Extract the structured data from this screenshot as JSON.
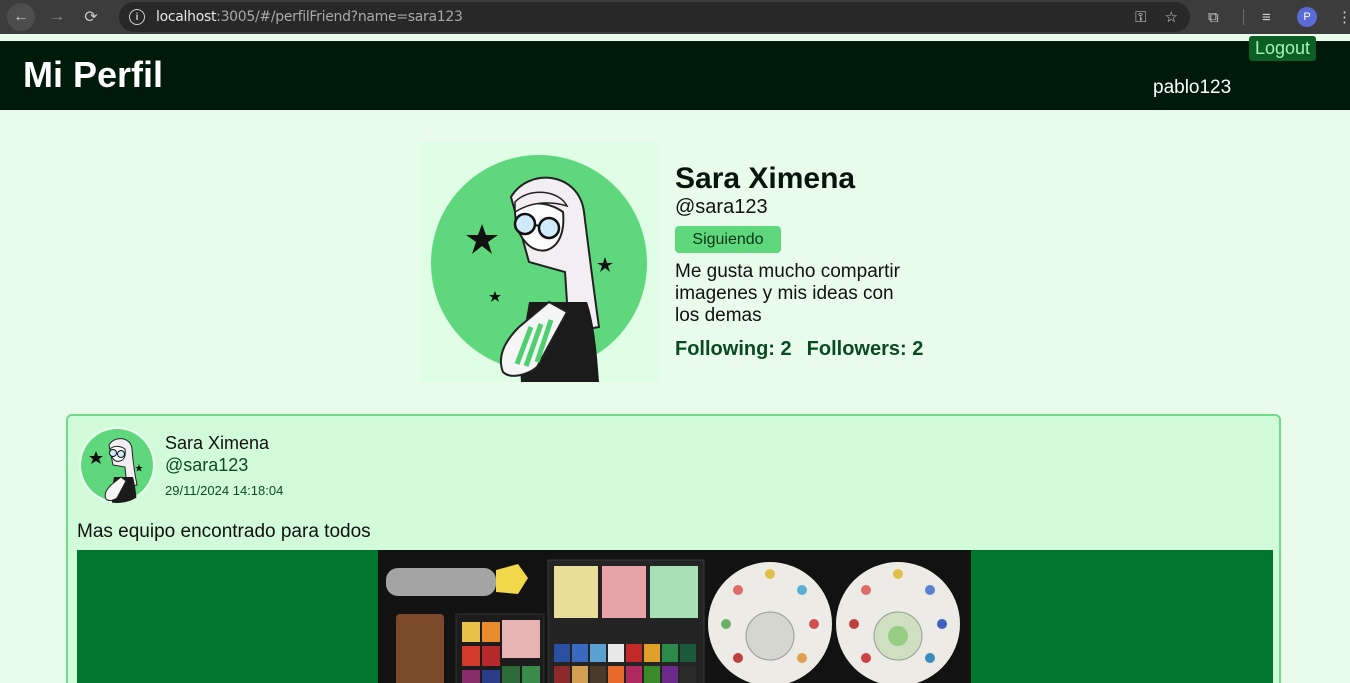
{
  "browser": {
    "url_host": "localhost",
    "url_rest": ":3005/#/perfilFriend?name=sara123",
    "profile_initial": "P"
  },
  "header": {
    "title": "Mi Perfil",
    "username": "pablo123",
    "logout_label": "Logout"
  },
  "profile": {
    "name": "Sara Ximena",
    "handle": "@sara123",
    "follow_state_label": "Siguiendo",
    "bio": "Me gusta mucho compartir imagenes y mis ideas con los demas",
    "following_label": "Following: 2",
    "followers_label": "Followers: 2"
  },
  "post": {
    "author_name": "Sara Ximena",
    "author_handle": "@sara123",
    "timestamp": "29/11/2024 14:18:04",
    "text": "Mas equipo encontrado para todos"
  },
  "colors": {
    "header_bg": "#001a0a",
    "page_bg": "#e9fcec",
    "accent": "#5fd77c",
    "post_bg": "#d1fbd9",
    "media_bg": "#00772f"
  }
}
